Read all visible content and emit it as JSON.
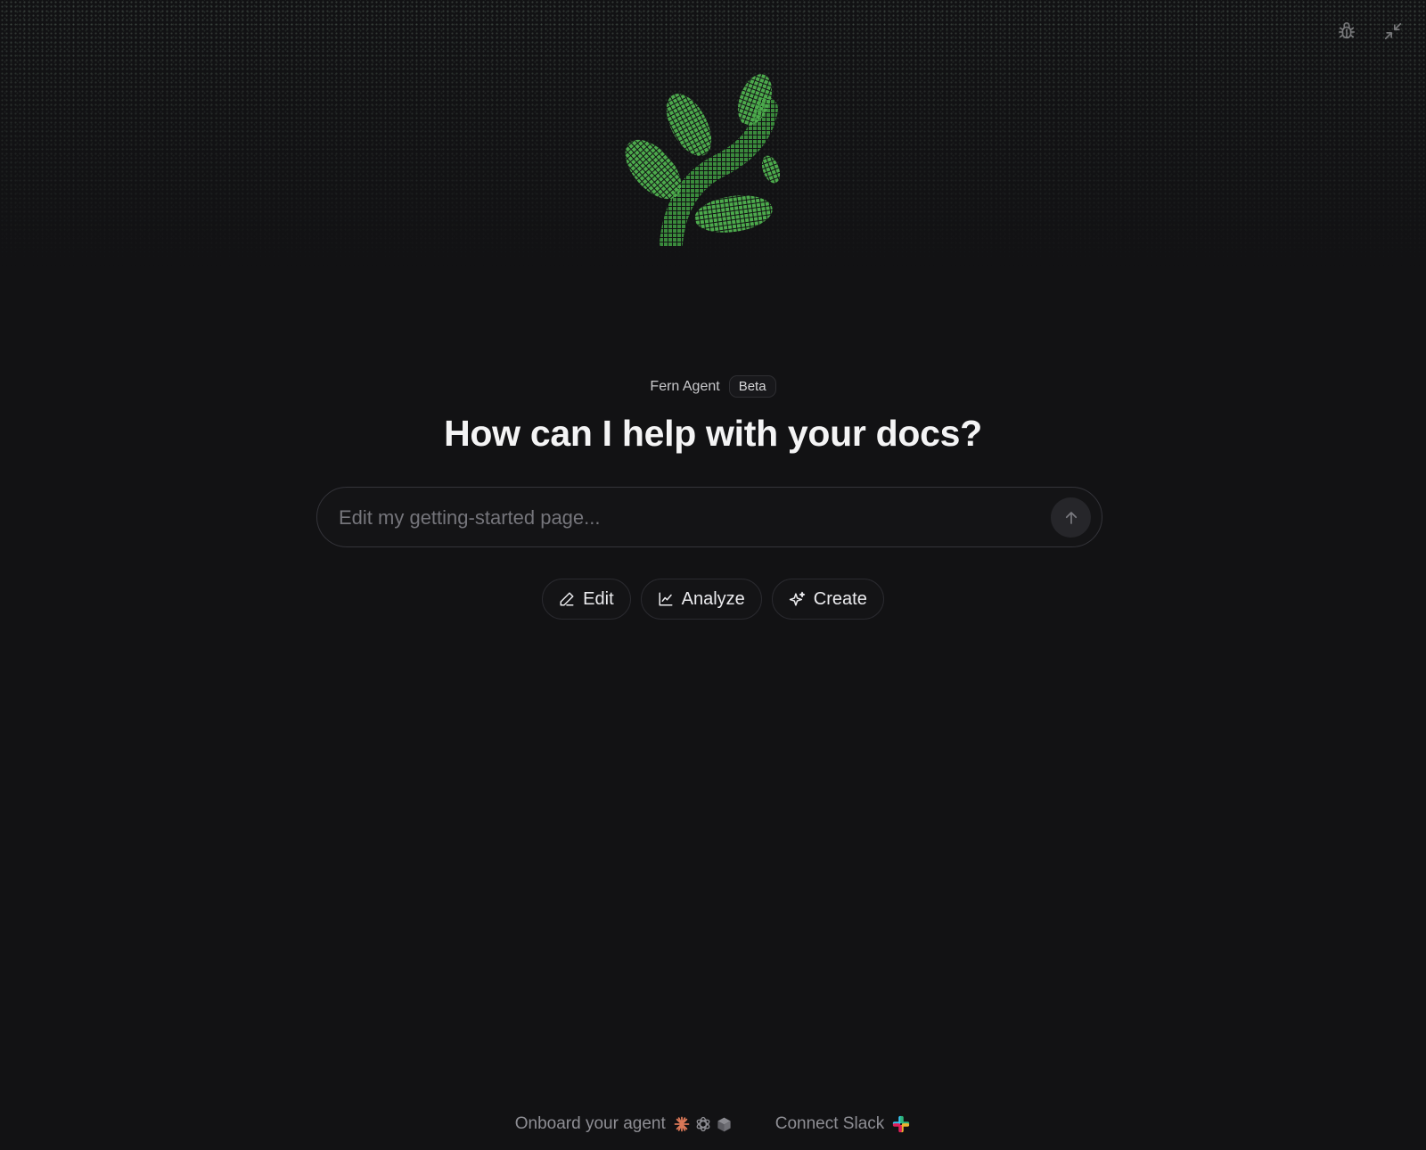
{
  "header": {
    "icons": [
      "bug-icon",
      "minimize-icon"
    ]
  },
  "agent": {
    "name": "Fern Agent",
    "badge": "Beta"
  },
  "headline": "How can I help with your docs?",
  "prompt": {
    "placeholder": "Edit my getting-started page...",
    "value": "",
    "send_icon": "arrow-up-icon"
  },
  "actions": [
    {
      "label": "Edit",
      "icon": "pencil-icon"
    },
    {
      "label": "Analyze",
      "icon": "line-chart-icon"
    },
    {
      "label": "Create",
      "icon": "sparkle-icon"
    }
  ],
  "footer": {
    "onboard_label": "Onboard your agent",
    "onboard_icons": [
      "claude-icon",
      "openai-icon",
      "cube-icon"
    ],
    "slack_label": "Connect Slack",
    "slack_icon": "slack-icon"
  },
  "colors": {
    "background": "#121214",
    "logo_green": "#4caa4c",
    "claude_orange": "#d97757"
  }
}
